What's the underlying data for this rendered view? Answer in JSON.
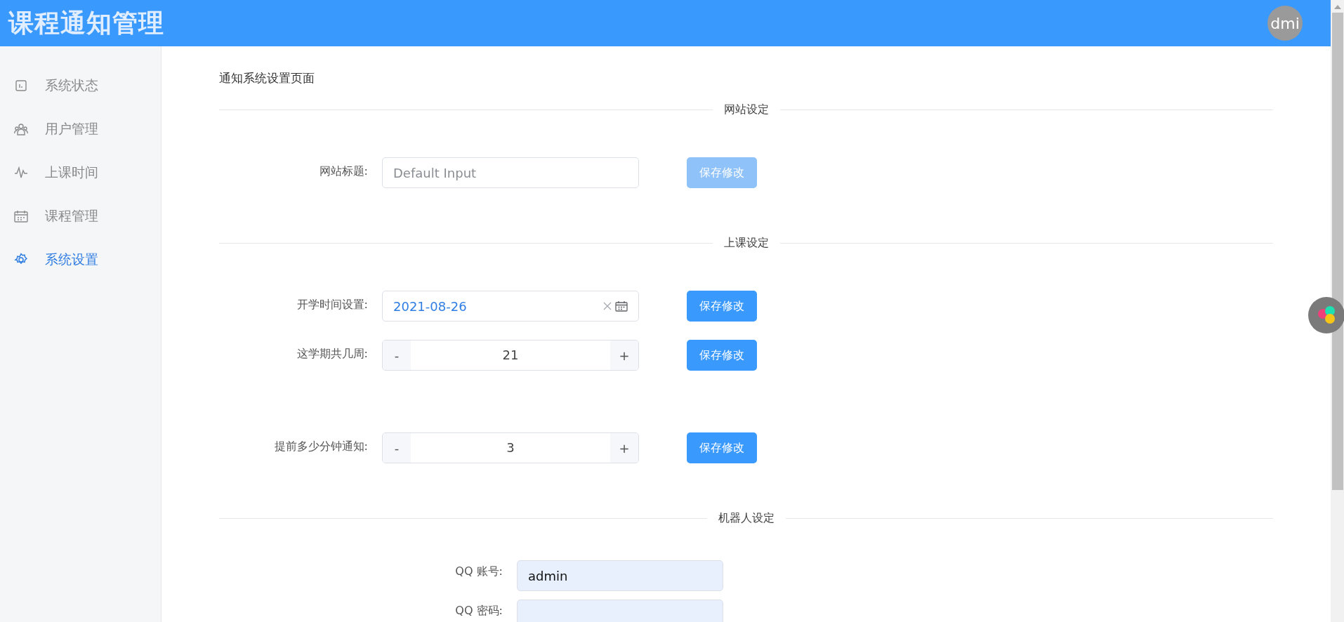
{
  "header": {
    "title": "课程通知管理",
    "avatar_text": "dmi"
  },
  "sidebar": {
    "items": [
      {
        "label": "系统状态",
        "selected": false
      },
      {
        "label": "用户管理",
        "selected": false
      },
      {
        "label": "上课时间",
        "selected": false
      },
      {
        "label": "课程管理",
        "selected": false
      },
      {
        "label": "系统设置",
        "selected": true
      }
    ]
  },
  "page_title": "通知系统设置页面",
  "sections": [
    {
      "title": "网站设定",
      "fields": [
        {
          "kind": "text",
          "label": "网站标题:",
          "placeholder": "Default Input",
          "button": {
            "label": "保存修改",
            "disabled": true
          }
        }
      ]
    },
    {
      "title": "上课设定",
      "fields": [
        {
          "kind": "date",
          "label": "开学时间设置:",
          "value": "2021-08-26",
          "button": {
            "label": "保存修改",
            "disabled": false
          }
        },
        {
          "kind": "number",
          "label": "这学期共几周:",
          "value": "21",
          "minus": "-",
          "plus": "+",
          "button": {
            "label": "保存修改",
            "disabled": false
          }
        },
        {
          "kind": "spacer"
        },
        {
          "kind": "number",
          "label": "提前多少分钟通知:",
          "value": "3",
          "minus": "-",
          "plus": "+",
          "button": {
            "label": "保存修改",
            "disabled": false
          }
        }
      ]
    },
    {
      "title": "机器人设定",
      "fields": [
        {
          "kind": "filled",
          "label": "QQ 账号:",
          "value": "admin"
        },
        {
          "kind": "filled",
          "label": "QQ 密码:"
        }
      ]
    }
  ]
}
